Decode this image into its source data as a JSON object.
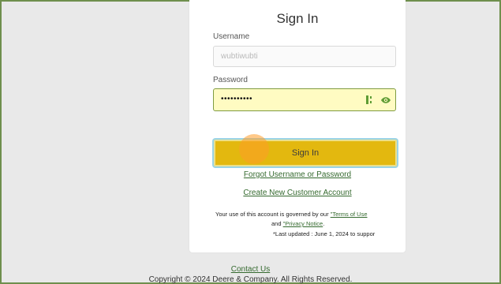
{
  "title": "Sign In",
  "form": {
    "username_label": "Username",
    "username_value": "wubtiwubti",
    "password_label": "Password",
    "password_value": "••••••••••",
    "key_icon": "password-key-icon",
    "eye_icon": "eye-icon",
    "sign_in_button": "Sign In"
  },
  "links": {
    "forgot": "Forgot Username or Password",
    "create": "Create New Customer Account",
    "contact": "Contact Us"
  },
  "notice": {
    "line1_prefix": "Your use of this account is governed by our ",
    "terms_link": "\"Terms of Use",
    "line2_prefix": "and ",
    "privacy_link": "\"Privacy Notice",
    "line2_suffix": ".",
    "line3": "*Last updated : June 1, 2024 to suppor"
  },
  "footer": {
    "copyright": "Copyright © 2024 Deere & Company. All Rights Reserved."
  },
  "colors": {
    "accent_green": "#356a2f",
    "button_yellow": "#e3b80f",
    "password_bg": "#fffbc2"
  }
}
